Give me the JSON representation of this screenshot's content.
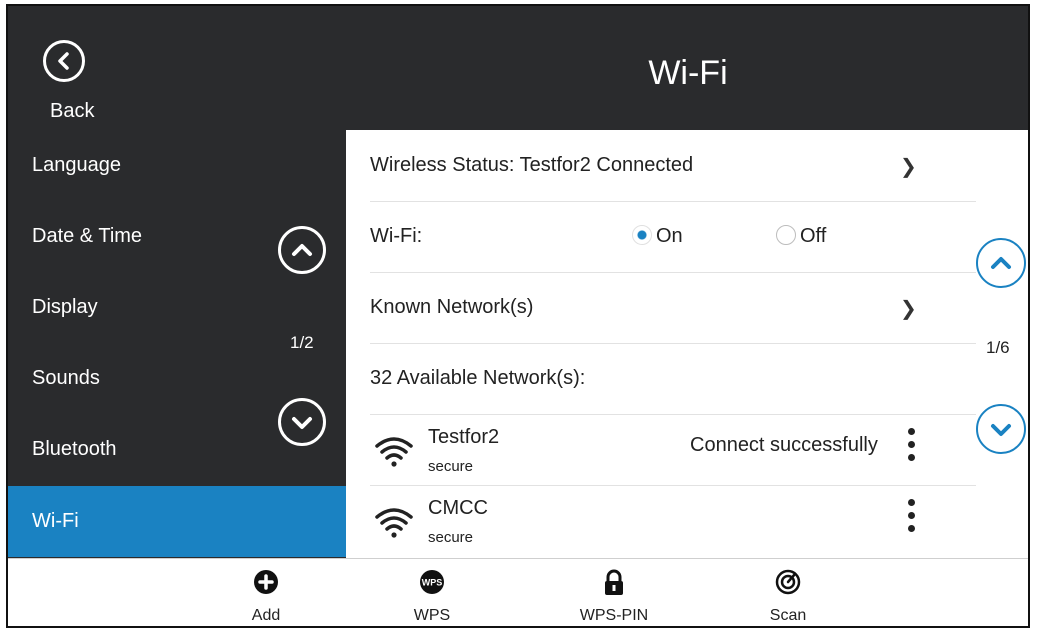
{
  "header": {
    "title": "Wi-Fi",
    "back_label": "Back"
  },
  "sidebar": {
    "items": [
      {
        "label": "Language"
      },
      {
        "label": "Date & Time"
      },
      {
        "label": "Display"
      },
      {
        "label": "Sounds"
      },
      {
        "label": "Bluetooth"
      },
      {
        "label": "Wi-Fi",
        "active": true
      }
    ],
    "page_indicator": "1/2"
  },
  "content": {
    "wireless_status": "Wireless Status: Testfor2 Connected",
    "wifi_label": "Wi-Fi:",
    "wifi_on_label": "On",
    "wifi_off_label": "Off",
    "wifi_selected": "On",
    "known_networks": "Known Network(s)",
    "available_networks": "32 Available Network(s):",
    "networks": [
      {
        "name": "Testfor2",
        "security": "secure",
        "status": "Connect successfully"
      },
      {
        "name": "CMCC",
        "security": "secure",
        "status": ""
      }
    ],
    "page_indicator": "1/6"
  },
  "softkeys": [
    {
      "label": "Add",
      "icon": "plus-circle-icon"
    },
    {
      "label": "WPS",
      "icon": "wps-icon",
      "icon_text": "WPS"
    },
    {
      "label": "WPS-PIN",
      "icon": "lock-icon"
    },
    {
      "label": "Scan",
      "icon": "scan-icon"
    }
  ],
  "colors": {
    "dark_bg": "#2a2b2d",
    "accent": "#1a82c2"
  }
}
